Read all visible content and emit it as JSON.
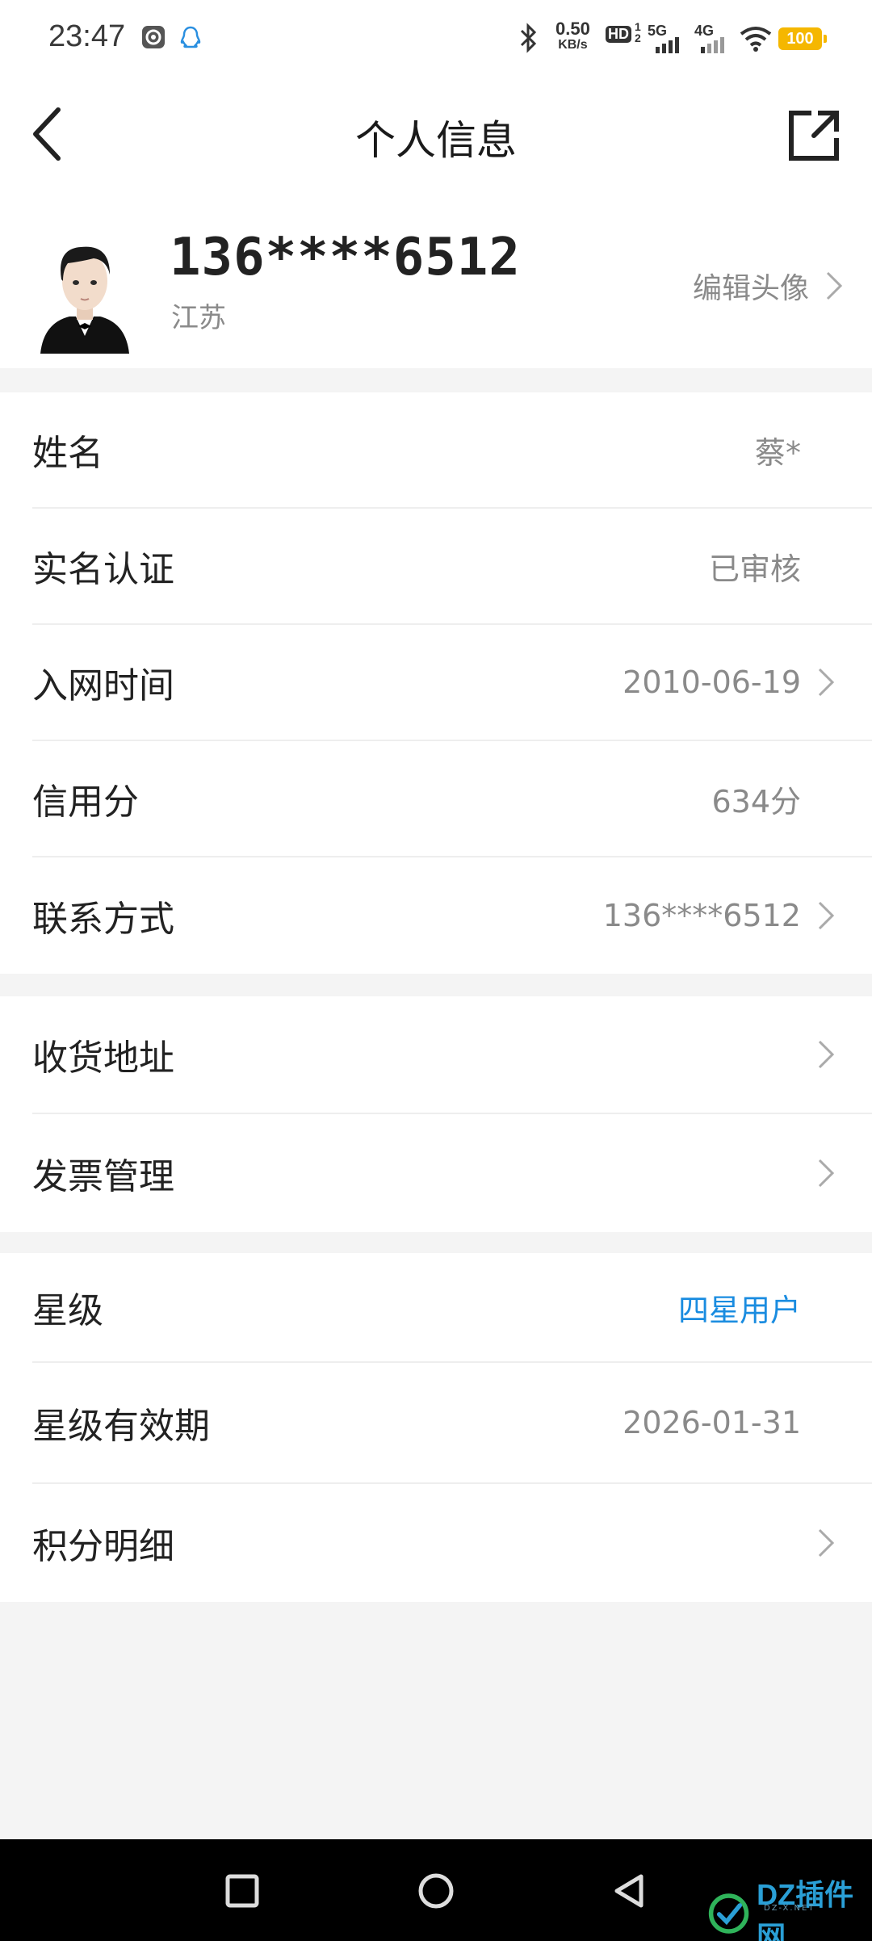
{
  "status_bar": {
    "time": "23:47",
    "speed_value": "0.50",
    "speed_unit": "KB/s",
    "hd_label": "HD",
    "net1": "5G",
    "net2": "4G",
    "battery": "100"
  },
  "header": {
    "title": "个人信息"
  },
  "profile": {
    "phone": "136****6512",
    "region": "江苏",
    "edit_avatar_label": "编辑头像"
  },
  "group1": [
    {
      "label": "姓名",
      "value": "蔡*"
    },
    {
      "label": "实名认证",
      "value": "已审核"
    },
    {
      "label": "入网时间",
      "value": "2010-06-19"
    },
    {
      "label": "信用分",
      "value": "634分"
    },
    {
      "label": "联系方式",
      "value": "136****6512"
    }
  ],
  "group2": [
    {
      "label": "收货地址"
    },
    {
      "label": "发票管理"
    }
  ],
  "group3": [
    {
      "label": "星级",
      "value": "四星用户",
      "value_color": "#1a8ce0"
    },
    {
      "label": "星级有效期",
      "value": "2026-01-31"
    },
    {
      "label": "积分明细"
    }
  ],
  "watermark": {
    "text": "DZ插件网",
    "sub": "DZ-X.NET"
  }
}
